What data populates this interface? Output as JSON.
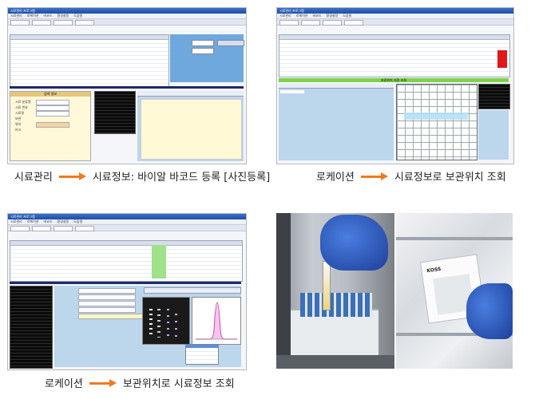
{
  "panels": {
    "top_left": {
      "window_title": "시료관리 프로그램",
      "menu": [
        "시료관리",
        "로케이션",
        "바코드",
        "환경설정",
        "도움말"
      ],
      "form_title": "검색 정보",
      "form_fields": [
        "시료 분류명",
        "시료 번호",
        "시료명",
        "보관",
        "위치",
        "비고"
      ]
    },
    "top_right": {
      "window_title": "시료관리 프로그램",
      "menu": [
        "시료관리",
        "로케이션",
        "바코드",
        "환경설정",
        "도움말"
      ],
      "section_title": "보관위치 지정 조회"
    },
    "bottom_left": {
      "window_title": "시료관리 프로그램",
      "menu": [
        "시료관리",
        "로케이션",
        "바코드",
        "환경설정",
        "도움말"
      ],
      "section_title": "시료정보 조회"
    }
  },
  "captions": {
    "top_left": {
      "from": "시료관리",
      "to": "시료정보: 바이알 바코드 등록 [사진등록]"
    },
    "top_right": {
      "from": "로케이션",
      "to": "시료정보로 보관위치 조회"
    },
    "bottom_left": {
      "from": "로케이션",
      "to": "보관위치로 시료정보 조회"
    }
  },
  "photo": {
    "box_brand": "KOSS"
  },
  "colors": {
    "arrow": "#f07a1e",
    "accent_blue": "#6fa8dc",
    "grid_green": "#7fd34a",
    "alert_red": "#e01818"
  }
}
